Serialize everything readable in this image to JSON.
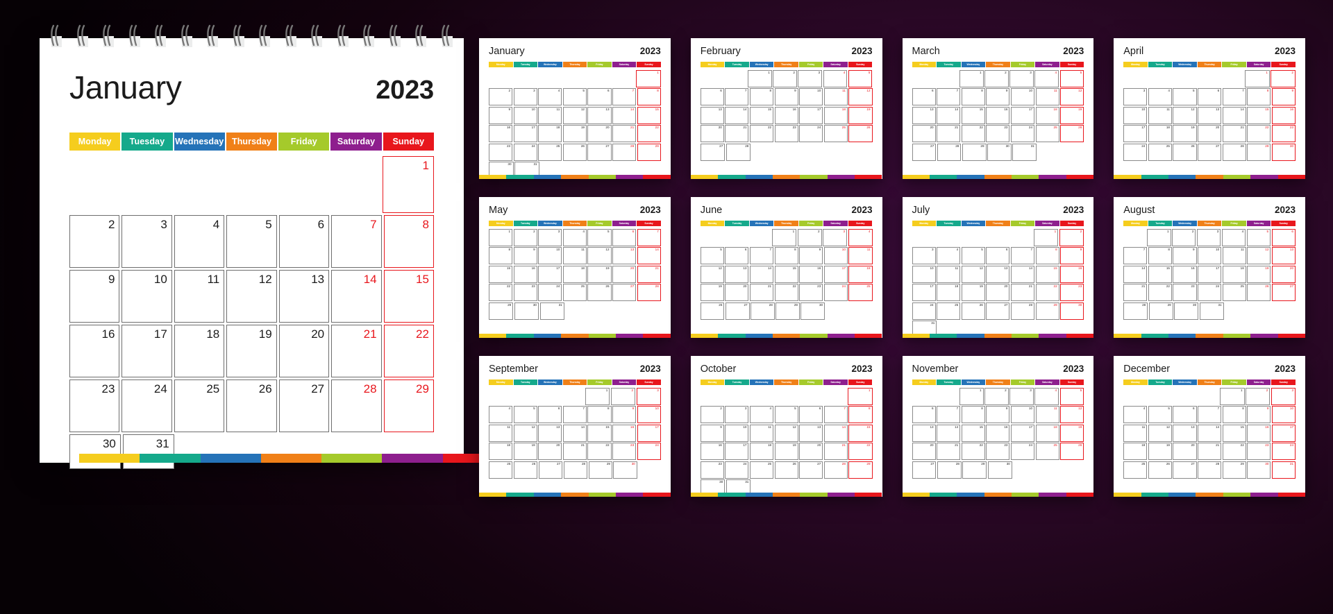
{
  "year": "2023",
  "palette": {
    "monday": "#f5cd1e",
    "tuesday": "#15a98b",
    "wednesday": "#2573b8",
    "thursday": "#f08018",
    "friday": "#a5ca2b",
    "saturday": "#8e1f8e",
    "sunday": "#e8161c",
    "background_dark": "#000000",
    "background_purple": "#3d0c3c",
    "page": "#ffffff",
    "cell_border": "#6d6d6d",
    "text": "#1b1b1b"
  },
  "weekdays": [
    "Monday",
    "Tuesday",
    "Wednesday",
    "Thursday",
    "Friday",
    "Saturday",
    "Sunday"
  ],
  "featured": {
    "month": "January",
    "year": "2023",
    "start_weekday_index": 6,
    "days_in_month": 31
  },
  "months": [
    {
      "name": "January",
      "year": "2023",
      "start_weekday_index": 6,
      "days": 31
    },
    {
      "name": "February",
      "year": "2023",
      "start_weekday_index": 2,
      "days": 28
    },
    {
      "name": "March",
      "year": "2023",
      "start_weekday_index": 2,
      "days": 31
    },
    {
      "name": "April",
      "year": "2023",
      "start_weekday_index": 5,
      "days": 30
    },
    {
      "name": "May",
      "year": "2023",
      "start_weekday_index": 0,
      "days": 31
    },
    {
      "name": "June",
      "year": "2023",
      "start_weekday_index": 3,
      "days": 30
    },
    {
      "name": "July",
      "year": "2023",
      "start_weekday_index": 5,
      "days": 31
    },
    {
      "name": "August",
      "year": "2023",
      "start_weekday_index": 1,
      "days": 31
    },
    {
      "name": "September",
      "year": "2023",
      "start_weekday_index": 4,
      "days": 30
    },
    {
      "name": "October",
      "year": "2023",
      "start_weekday_index": 6,
      "days": 31
    },
    {
      "name": "November",
      "year": "2023",
      "start_weekday_index": 2,
      "days": 30
    },
    {
      "name": "December",
      "year": "2023",
      "start_weekday_index": 4,
      "days": 31
    }
  ],
  "binding": {
    "coil_count": 16,
    "icon": "spiral-wire-icon"
  }
}
